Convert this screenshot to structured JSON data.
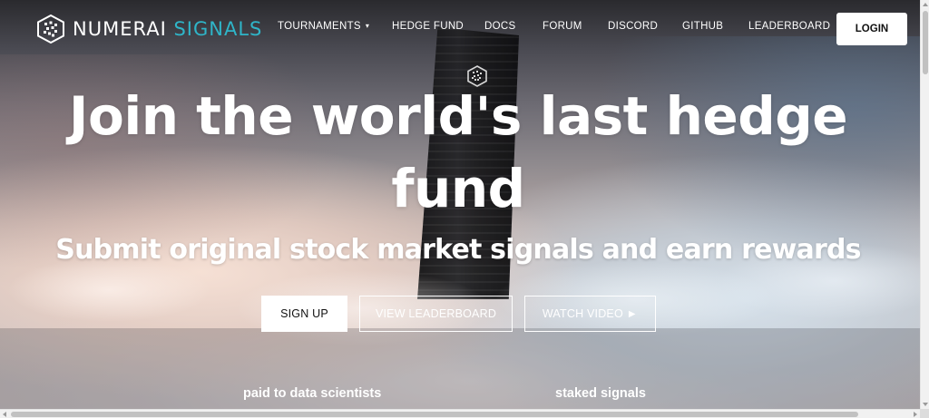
{
  "brand": {
    "name_main": "NUMERAI",
    "name_accent": "SIGNALS",
    "logo_icon": "numerai-cube-icon",
    "accent_color": "#2fb5c8"
  },
  "nav": {
    "items": [
      {
        "label": "TOURNAMENTS",
        "has_dropdown": true,
        "caret": "▾"
      },
      {
        "label": "HEDGE FUND"
      },
      {
        "label": "DOCS"
      },
      {
        "label": "FORUM"
      },
      {
        "label": "DISCORD"
      },
      {
        "label": "GITHUB"
      },
      {
        "label": "LEADERBOARD"
      }
    ],
    "login_label": "LOGIN"
  },
  "hero": {
    "title_line1": "Join the world's last hedge",
    "title_line2": "fund",
    "subtitle": "Submit original stock market signals and earn rewards",
    "buttons": {
      "signup": "SIGN UP",
      "leaderboard": "VIEW LEADERBOARD",
      "video": "WATCH VIDEO ►"
    }
  },
  "stats": {
    "left_label": "paid to data scientists",
    "right_label": "staked signals"
  }
}
